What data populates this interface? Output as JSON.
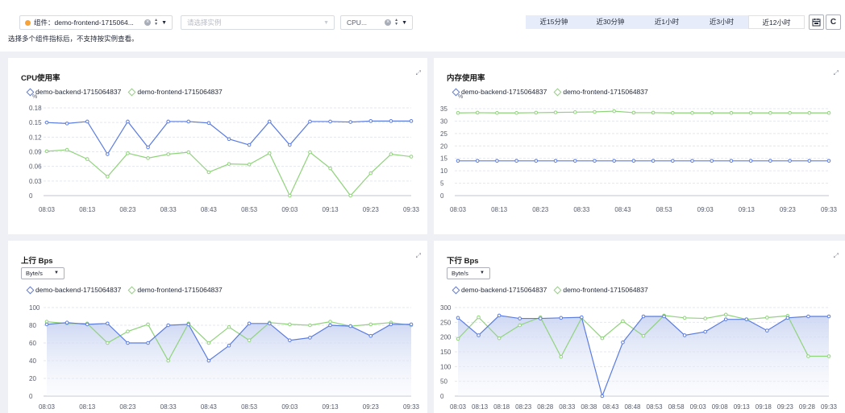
{
  "filters": {
    "component_label": "组件：demo-frontend-1715064...",
    "instance_placeholder": "请选择实例",
    "metric_label": "CPU...",
    "hint": "选择多个组件指标后，不支持按实例查看。"
  },
  "time_range": {
    "options": [
      "近15分钟",
      "近30分钟",
      "近1小时",
      "近3小时",
      "近12小时"
    ],
    "active": "近12小时"
  },
  "colors": {
    "backend": "#5b7ce0",
    "frontend": "#8fd37a",
    "fill": "#dfe6f7"
  },
  "legend": {
    "backend": "demo-backend-1715064837",
    "frontend": "demo-frontend-1715064837"
  },
  "panels": {
    "cpu": {
      "title": "CPU使用率",
      "unit": "%"
    },
    "mem": {
      "title": "内存使用率",
      "unit": "%"
    },
    "up": {
      "title": "上行 Bps",
      "unit_select": "Byte/s"
    },
    "down": {
      "title": "下行 Bps",
      "unit_select": "Byte/s"
    }
  },
  "chart_data": [
    {
      "id": "cpu",
      "type": "line",
      "title": "CPU使用率",
      "ylabel": "%",
      "ylim": [
        0,
        0.18
      ],
      "yticks": [
        "0",
        "0.03",
        "0.06",
        "0.09",
        "0.12",
        "0.15",
        "0.18"
      ],
      "xticks": [
        "08:03",
        "08:13",
        "08:23",
        "08:33",
        "08:43",
        "08:53",
        "09:03",
        "09:13",
        "09:23",
        "09:33"
      ],
      "n": 19,
      "series": [
        {
          "name": "demo-backend-1715064837",
          "values": [
            0.15,
            0.148,
            0.152,
            0.085,
            0.152,
            0.099,
            0.152,
            0.152,
            0.149,
            0.116,
            0.104,
            0.152,
            0.104,
            0.152,
            0.152,
            0.151,
            0.153,
            0.153,
            0.153
          ]
        },
        {
          "name": "demo-frontend-1715064837",
          "values": [
            0.091,
            0.094,
            0.075,
            0.039,
            0.087,
            0.077,
            0.085,
            0.089,
            0.048,
            0.065,
            0.064,
            0.087,
            0.0,
            0.089,
            0.056,
            0.0,
            0.046,
            0.085,
            0.08
          ]
        }
      ]
    },
    {
      "id": "mem",
      "type": "line",
      "title": "内存使用率",
      "ylabel": "%",
      "ylim": [
        0,
        35
      ],
      "yticks": [
        "0",
        "5",
        "10",
        "15",
        "20",
        "25",
        "30",
        "35"
      ],
      "xticks": [
        "08:03",
        "08:13",
        "08:23",
        "08:33",
        "08:43",
        "08:53",
        "09:03",
        "09:13",
        "09:23",
        "09:33"
      ],
      "n": 20,
      "series": [
        {
          "name": "demo-backend-1715064837",
          "values": [
            14,
            14,
            14,
            14,
            14,
            14,
            14,
            14,
            14,
            14,
            14,
            14,
            14,
            14,
            14,
            14,
            14,
            14,
            14,
            14
          ]
        },
        {
          "name": "demo-frontend-1715064837",
          "values": [
            33.3,
            33.4,
            33.3,
            33.3,
            33.4,
            33.5,
            33.6,
            33.7,
            34.0,
            33.4,
            33.4,
            33.3,
            33.3,
            33.3,
            33.3,
            33.3,
            33.3,
            33.3,
            33.3,
            33.3
          ]
        }
      ]
    },
    {
      "id": "up",
      "type": "area",
      "title": "上行 Bps",
      "ylim": [
        0,
        100
      ],
      "yticks": [
        "0",
        "20",
        "40",
        "60",
        "80",
        "100"
      ],
      "xticks": [
        "08:03",
        "08:13",
        "08:23",
        "08:33",
        "08:43",
        "08:53",
        "09:03",
        "09:13",
        "09:23",
        "09:33"
      ],
      "n": 19,
      "series": [
        {
          "name": "demo-backend-1715064837",
          "values": [
            81,
            83,
            81,
            82,
            60,
            60,
            80,
            81,
            40,
            57,
            82,
            82,
            63,
            66,
            80,
            79,
            68,
            81,
            81
          ]
        },
        {
          "name": "demo-frontend-1715064837",
          "values": [
            84,
            82,
            82,
            60,
            73,
            81,
            40,
            82,
            60,
            78,
            63,
            83,
            81,
            80,
            84,
            79,
            81,
            83,
            80
          ]
        }
      ]
    },
    {
      "id": "down",
      "type": "area",
      "title": "下行 Bps",
      "ylim": [
        0,
        300
      ],
      "yticks": [
        "0",
        "50",
        "100",
        "150",
        "200",
        "250",
        "300"
      ],
      "xticks": [
        "08:03",
        "08:13",
        "08:18",
        "08:23",
        "08:28",
        "08:33",
        "08:38",
        "08:43",
        "08:48",
        "08:53",
        "08:58",
        "09:03",
        "09:08",
        "09:13",
        "09:18",
        "09:23",
        "09:28",
        "09:33"
      ],
      "n": 19,
      "series": [
        {
          "name": "demo-backend-1715064837",
          "values": [
            265,
            206,
            273,
            263,
            263,
            265,
            267,
            0,
            182,
            270,
            270,
            206,
            218,
            260,
            260,
            222,
            265,
            270,
            270
          ]
        },
        {
          "name": "demo-frontend-1715064837",
          "values": [
            194,
            267,
            196,
            240,
            267,
            133,
            265,
            196,
            254,
            204,
            273,
            265,
            263,
            276,
            260,
            266,
            272,
            135,
            135
          ]
        }
      ]
    }
  ]
}
